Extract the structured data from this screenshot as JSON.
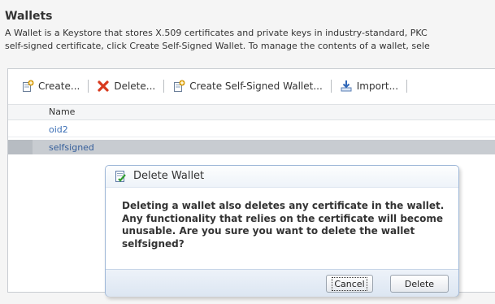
{
  "page": {
    "title": "Wallets",
    "description_line1": "A Wallet is a Keystore that stores X.509 certificates and private keys in industry-standard, PKC",
    "description_line2": "self-signed certificate, click Create Self-Signed Wallet. To manage the contents of a wallet, sele"
  },
  "toolbar": {
    "create_label": "Create...",
    "delete_label": "Delete...",
    "create_self_signed_label": "Create Self-Signed Wallet...",
    "import_label": "Import..."
  },
  "table": {
    "column_name": "Name",
    "rows": [
      "oid2",
      "selfsigned"
    ]
  },
  "dialog": {
    "title": "Delete Wallet",
    "message": "Deleting a wallet also deletes any certificate in the wallet. Any functionality that relies on the certificate will become unusable. Are you sure you want to delete the wallet selfsigned?",
    "cancel_label": "Cancel",
    "delete_label": "Delete"
  },
  "icons": {
    "create": "create-document-icon",
    "delete": "red-x-icon",
    "create_self_signed": "create-document-icon",
    "import": "import-arrow-icon",
    "dialog": "checklist-icon"
  }
}
